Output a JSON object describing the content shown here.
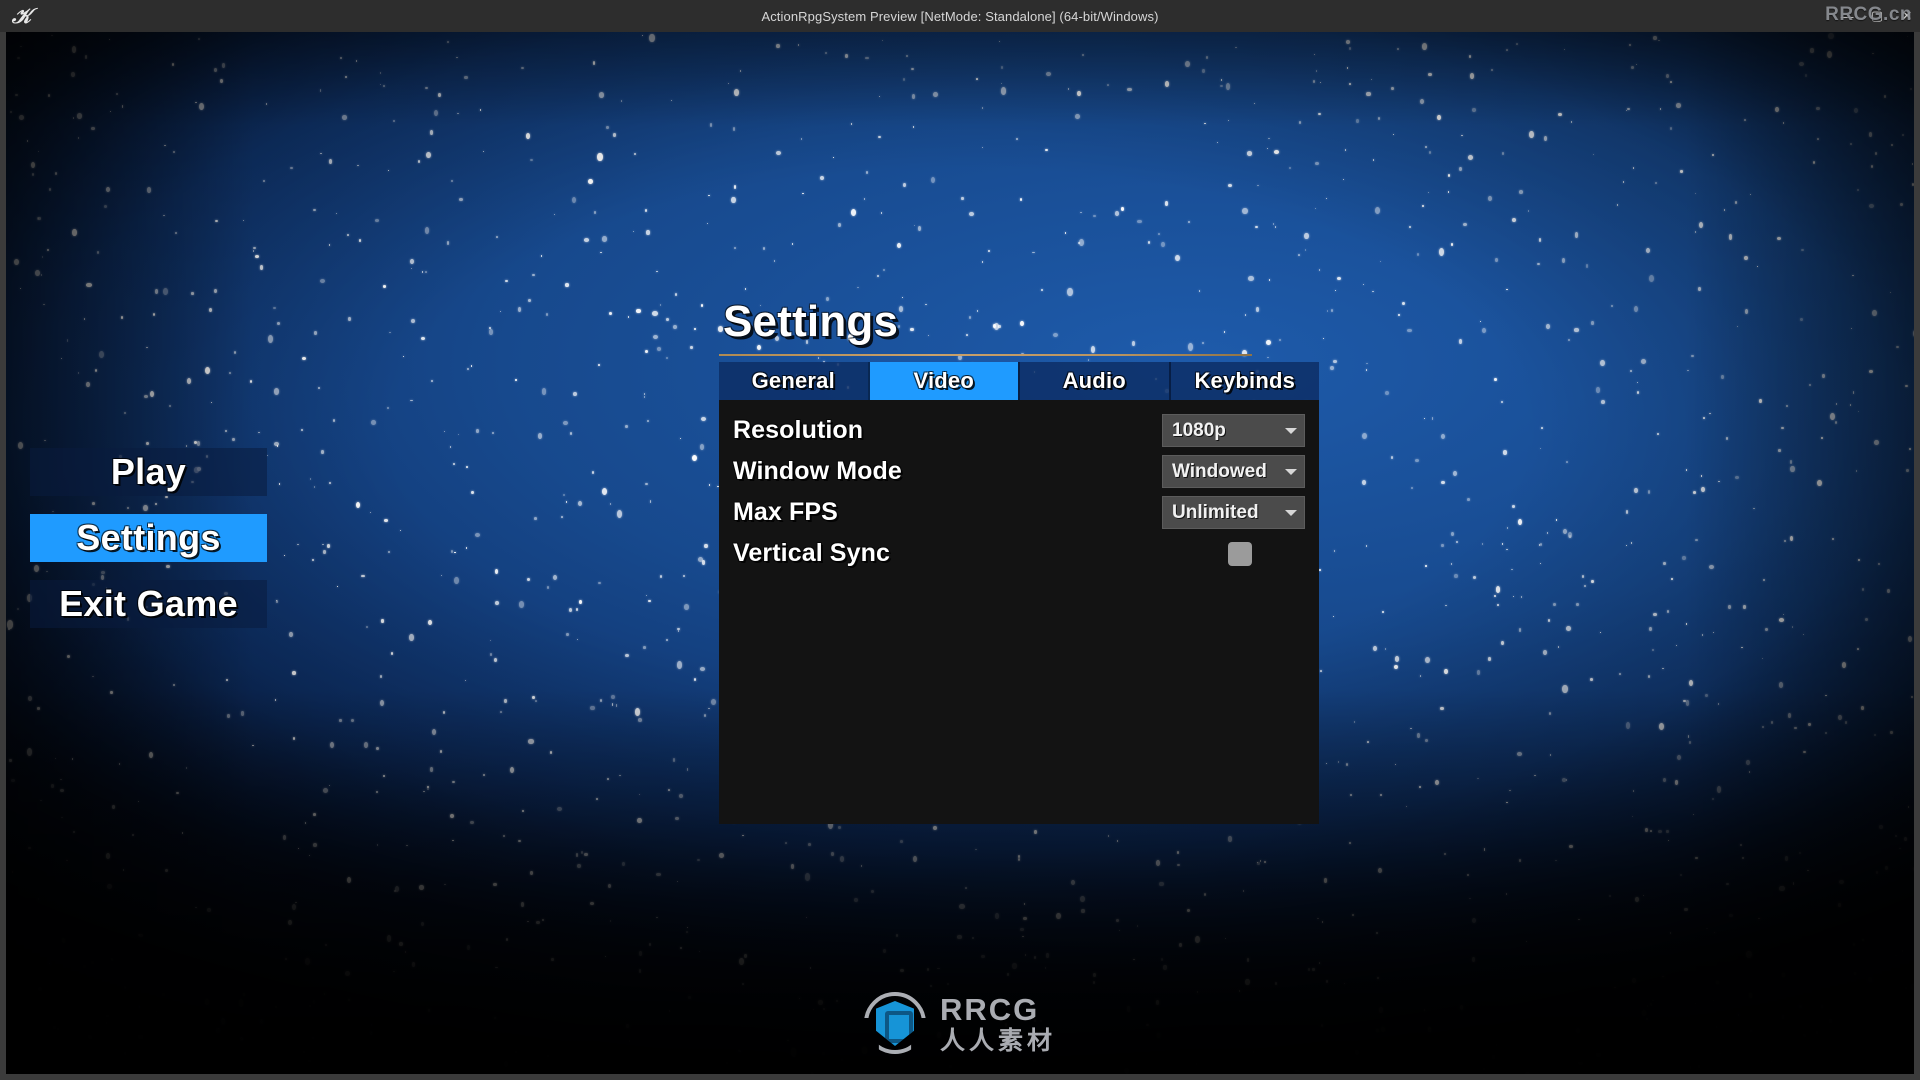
{
  "window": {
    "title": "ActionRpgSystem Preview [NetMode: Standalone]  (64-bit/Windows)",
    "engine_logo": "unreal-engine-logo",
    "controls": {
      "minimize": "—",
      "maximize": "▢",
      "close": "✕"
    }
  },
  "watermarks": {
    "top_right": "RRCG.cn",
    "bottom_brand": "RRCG",
    "bottom_subtitle": "人人素材"
  },
  "main_menu": {
    "items": [
      {
        "label": "Play",
        "selected": false
      },
      {
        "label": "Settings",
        "selected": true
      },
      {
        "label": "Exit Game",
        "selected": false
      }
    ]
  },
  "settings": {
    "title": "Settings",
    "tabs": [
      {
        "label": "General",
        "active": false
      },
      {
        "label": "Video",
        "active": true
      },
      {
        "label": "Audio",
        "active": false
      },
      {
        "label": "Keybinds",
        "active": false
      }
    ],
    "rows": [
      {
        "label": "Resolution",
        "type": "dropdown",
        "value": "1080p"
      },
      {
        "label": "Window Mode",
        "type": "dropdown",
        "value": "Windowed"
      },
      {
        "label": "Max FPS",
        "type": "dropdown",
        "value": "Unlimited"
      },
      {
        "label": "Vertical Sync",
        "type": "checkbox",
        "value": "unchecked"
      }
    ]
  },
  "colors": {
    "accent_blue": "#1f9bff",
    "tabbar_blue": "#0c2d64",
    "panel_black": "#131313",
    "divider_gold": "#caa16a",
    "combo_gray": "#4b4b4b",
    "checkbox_gray": "#9b9b9b",
    "titlebar": "#2d2d2d",
    "sky_blue": "#17498d"
  }
}
